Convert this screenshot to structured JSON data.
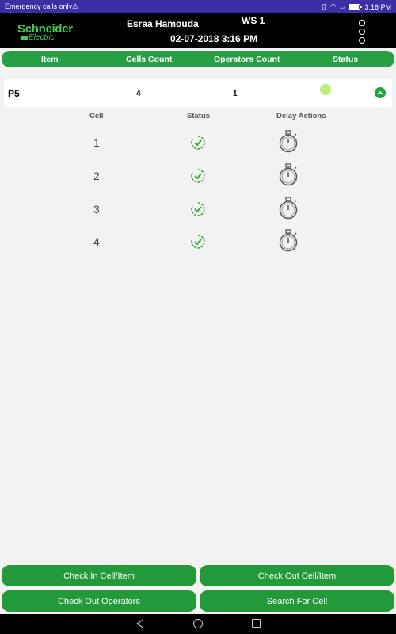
{
  "status_bar": {
    "left_text": "Emergency calls only⚠",
    "time": "3:16 PM",
    "battery_level": 0.85
  },
  "header": {
    "brand_line1": "Schneider",
    "brand_line2": "Electric",
    "user_name": "Esraa Hamouda",
    "workstation": "WS 1",
    "datetime": "02-07-2018 3:16 PM"
  },
  "columns": {
    "item": "Item",
    "cells_count": "Cells Count",
    "operators_count": "Operators Count",
    "status": "Status"
  },
  "item": {
    "name": "P5",
    "cells_count": "4",
    "operators_count": "1",
    "status_color": "#b7ef7c"
  },
  "cells_table": {
    "headers": {
      "cell": "Cell",
      "status": "Status",
      "delay": "Delay Actions"
    },
    "rows": [
      {
        "cell": "1"
      },
      {
        "cell": "2"
      },
      {
        "cell": "3"
      },
      {
        "cell": "4"
      }
    ]
  },
  "buttons": {
    "check_in": "Check In Cell/Item",
    "check_out": "Check Out Cell/Item",
    "check_out_operators": "Check Out Operators",
    "search_cell": "Search For Cell"
  },
  "colors": {
    "accent": "#27a043",
    "status_bar": "#3c2fa6"
  }
}
